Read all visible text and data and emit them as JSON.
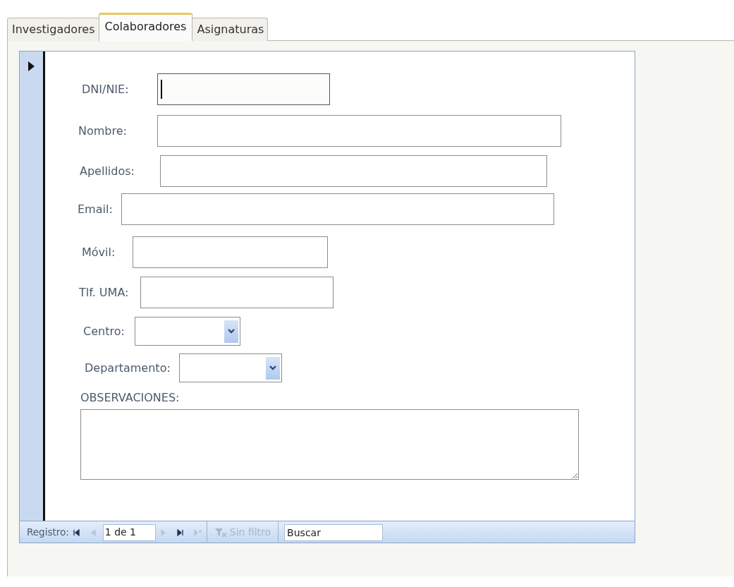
{
  "tabs": [
    {
      "label": "Investigadores",
      "selected": false
    },
    {
      "label": "Colaboradores",
      "selected": true
    },
    {
      "label": "Asignaturas",
      "selected": false
    }
  ],
  "form": {
    "fields": [
      {
        "kind": "text",
        "label": "DNI/NIE:",
        "focused": true
      },
      {
        "kind": "text",
        "label": "Nombre:",
        "focused": false
      },
      {
        "kind": "text",
        "label": "Apellidos:",
        "focused": false
      },
      {
        "kind": "text",
        "label": "Email:",
        "focused": false
      },
      {
        "kind": "text",
        "label": "Móvil:",
        "focused": false
      },
      {
        "kind": "text",
        "label": "Tlf. UMA:",
        "focused": false
      },
      {
        "kind": "combo",
        "label": "Centro:",
        "focused": false
      },
      {
        "kind": "combo",
        "label": "Departamento:",
        "focused": false
      },
      {
        "kind": "memo",
        "label": "OBSERVACIONES:",
        "focused": false
      }
    ]
  },
  "navigation": {
    "label": "Registro:",
    "position": "1 de 1",
    "buttons": [
      {
        "kind": "first",
        "disabled": false
      },
      {
        "kind": "prev",
        "disabled": true
      },
      {
        "kind": "next",
        "disabled": true
      },
      {
        "kind": "last",
        "disabled": false
      },
      {
        "kind": "new",
        "disabled": true
      }
    ],
    "filter": {
      "label": "Sin filtro",
      "disabled": true
    },
    "search": {
      "placeholder": "Buscar"
    }
  }
}
